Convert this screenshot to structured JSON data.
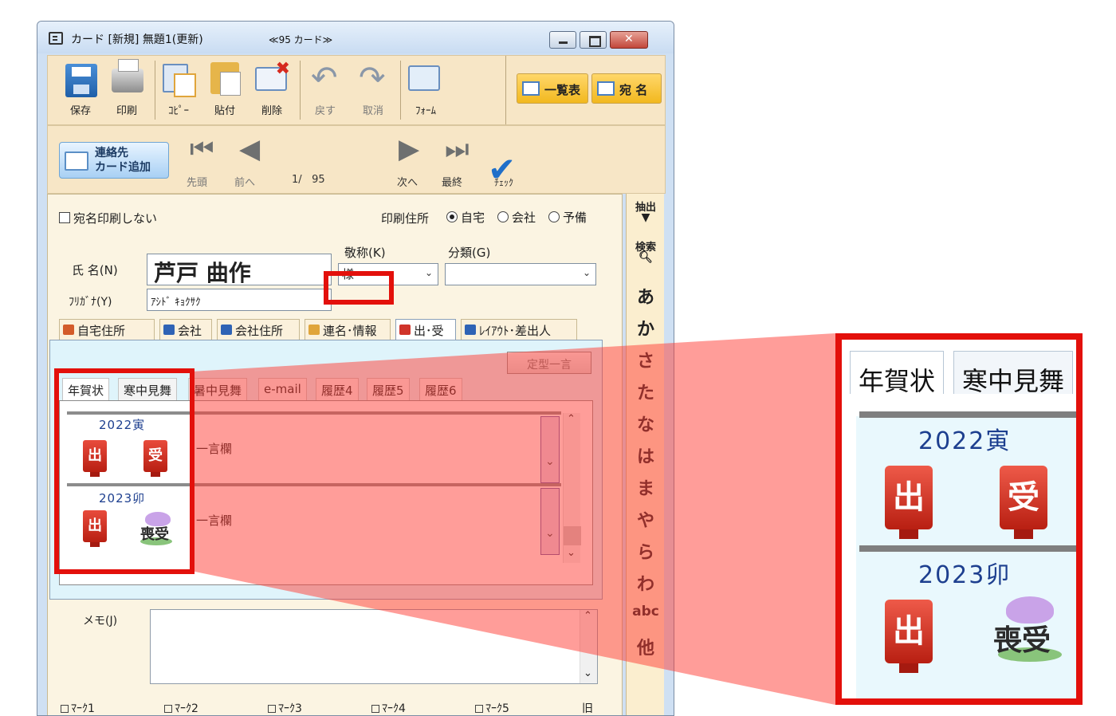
{
  "window": {
    "title": "カード [新規] 無題1(更新)",
    "count_label": "≪95 カード≫"
  },
  "toolbar": {
    "save": "保存",
    "print": "印刷",
    "copy": "ｺﾋﾟｰ",
    "paste": "貼付",
    "delete": "削除",
    "undo": "戻す",
    "cancel": "取消",
    "form": "ﾌｫｰﾑ",
    "list_view": "一覧表",
    "address": "宛 名"
  },
  "nav": {
    "add_contact": "連絡先\nカード追加",
    "first": "先頭",
    "prev": "前へ",
    "page_current": "1",
    "page_total": "95",
    "next": "次へ",
    "last": "最終",
    "check": "ﾁｪｯｸ"
  },
  "form": {
    "no_print_label": "宛名印刷しない",
    "print_addr_label": "印刷住所",
    "addr_options": [
      "自宅",
      "会社",
      "予備"
    ],
    "addr_selected": "自宅",
    "name_label": "氏 名(N)",
    "name_value": "芦戸 曲作",
    "furigana_label": "ﾌﾘｶﾞﾅ(Y)",
    "furigana_value": "ｱｼﾄﾞ ｷｮｸｻｸ",
    "honorific_label": "敬称(K)",
    "honorific_value": "様",
    "category_label": "分類(G)",
    "category_value": ""
  },
  "tabs": [
    "自宅住所",
    "会社",
    "会社住所",
    "連名･情報",
    "出･受",
    "ﾚｲｱｳﾄ･差出人"
  ],
  "active_tab": "出･受",
  "panel": {
    "teikei_button": "定型一言",
    "inner_tabs": [
      "年賀状",
      "寒中見舞",
      "暑中見舞",
      "e-mail",
      "履歴4",
      "履歴5",
      "履歴6"
    ],
    "active_inner_tab": "年賀状",
    "records": [
      {
        "year": "2022寅",
        "sent": "出",
        "received": "受",
        "comment_label": "一言欄"
      },
      {
        "year": "2023卯",
        "sent": "出",
        "received": "喪受",
        "comment_label": "一言欄"
      }
    ]
  },
  "memo_label": "メモ(J)",
  "marks": [
    "ﾏｰｸ1",
    "ﾏｰｸ2",
    "ﾏｰｸ3",
    "ﾏｰｸ4",
    "ﾏｰｸ5"
  ],
  "marks_extra": "旧",
  "side_index": {
    "extract": "抽出",
    "search": "検索",
    "kana": [
      "あ",
      "か",
      "さ",
      "た",
      "な",
      "は",
      "ま",
      "や",
      "ら",
      "わ",
      "abc",
      "他"
    ]
  },
  "colors": {
    "highlight": "#e3100b",
    "toolbar_bg": "#f7e6c6",
    "stamp_red": "#d0342a",
    "year_blue": "#1d3f8f"
  }
}
